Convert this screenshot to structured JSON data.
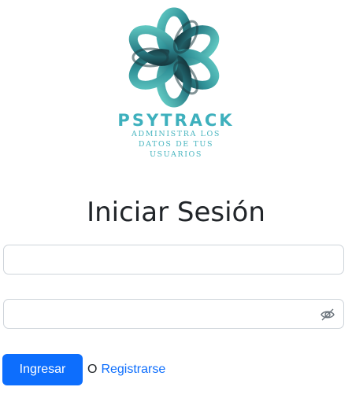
{
  "brand": {
    "logo_icon": "knot-flower-logo",
    "name": "PSYTRACK",
    "tagline": "ADMINISTRA LOS DATOS DE TUS USUARIOS"
  },
  "login": {
    "title": "Iniciar Sesión",
    "username": {
      "value": "",
      "placeholder": ""
    },
    "password": {
      "value": "",
      "placeholder": "",
      "toggle_icon": "eye-slash-icon"
    },
    "submit_label": "Ingresar",
    "or_text": "O",
    "register_label": "Registrarse"
  },
  "colors": {
    "brand_teal": "#3eb0bd",
    "primary": "#0d6efd",
    "text": "#212529",
    "border": "#ced4da"
  }
}
